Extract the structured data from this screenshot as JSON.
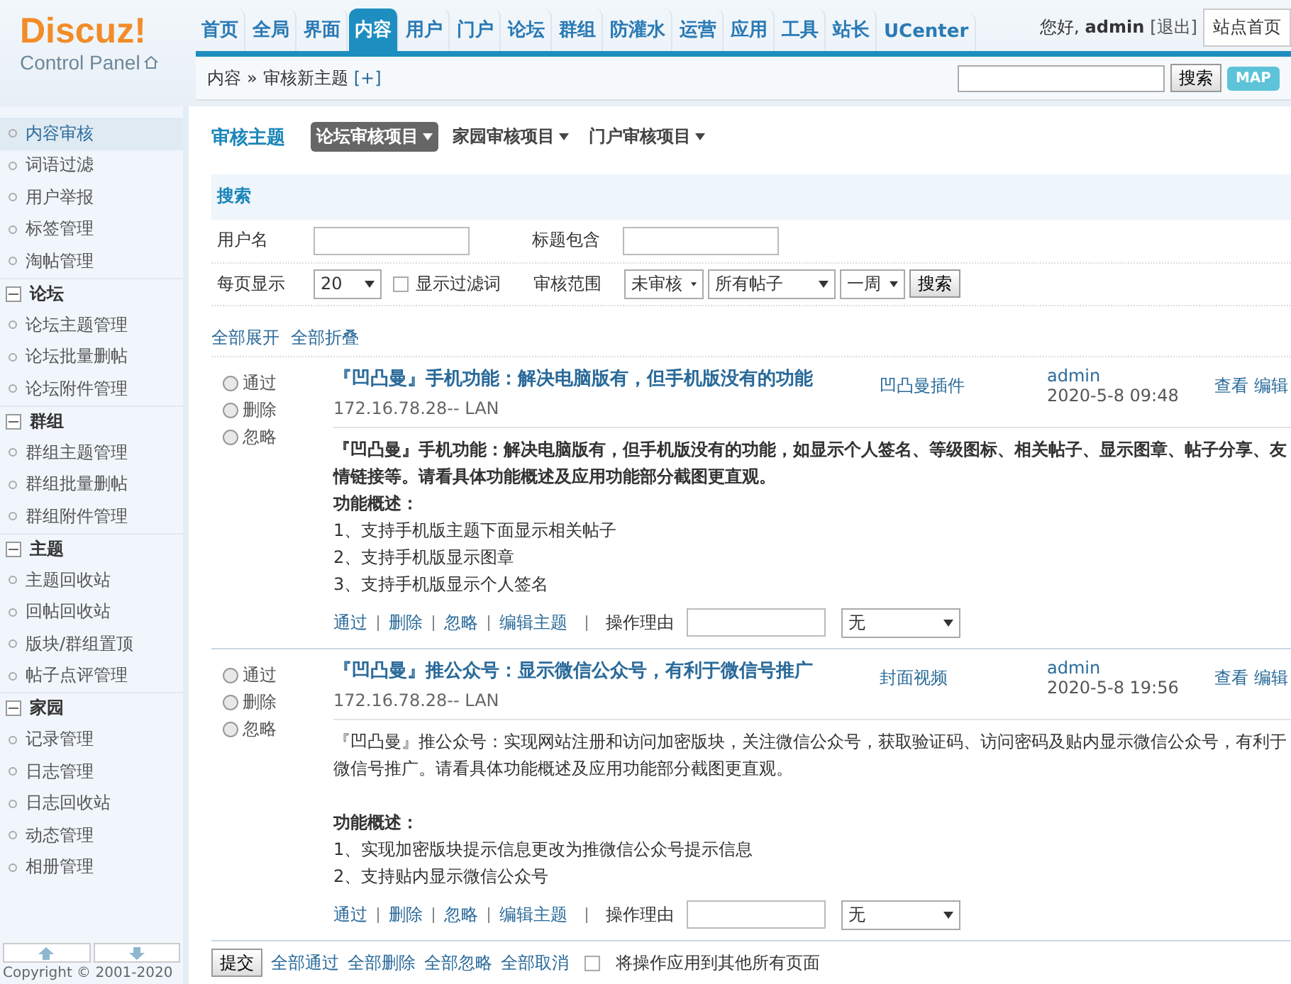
{
  "logo": {
    "title": "Discuz!",
    "subtitle": "Control Panel"
  },
  "nav": [
    {
      "label": "首页",
      "selected": false
    },
    {
      "label": "全局",
      "selected": false
    },
    {
      "label": "界面",
      "selected": false
    },
    {
      "label": "内容",
      "selected": true
    },
    {
      "label": "用户",
      "selected": false
    },
    {
      "label": "门户",
      "selected": false
    },
    {
      "label": "论坛",
      "selected": false
    },
    {
      "label": "群组",
      "selected": false
    },
    {
      "label": "防灌水",
      "selected": false
    },
    {
      "label": "运营",
      "selected": false
    },
    {
      "label": "应用",
      "selected": false
    },
    {
      "label": "工具",
      "selected": false
    },
    {
      "label": "站长",
      "selected": false
    },
    {
      "label": "UCenter",
      "selected": false
    }
  ],
  "user": {
    "greeting": "您好,",
    "name": "admin",
    "logout": "[退出]",
    "home": "站点首页"
  },
  "breadcrumb": {
    "section": "内容",
    "separator": "»",
    "page": "审核新主题",
    "add": "[+]"
  },
  "top_search": {
    "button": "搜索",
    "map": "MAP"
  },
  "sidebar": {
    "items": [
      {
        "label": "内容审核",
        "selected": true
      },
      {
        "label": "词语过滤",
        "selected": false
      },
      {
        "label": "用户举报",
        "selected": false
      },
      {
        "label": "标签管理",
        "selected": false
      },
      {
        "label": "淘帖管理",
        "selected": false
      }
    ],
    "groups": [
      {
        "title": "论坛",
        "expanded": true,
        "items": [
          {
            "label": "论坛主题管理",
            "selected": false
          },
          {
            "label": "论坛批量删帖",
            "selected": false
          },
          {
            "label": "论坛附件管理",
            "selected": false
          }
        ]
      },
      {
        "title": "群组",
        "expanded": true,
        "items": [
          {
            "label": "群组主题管理",
            "selected": false
          },
          {
            "label": "群组批量删帖",
            "selected": false
          },
          {
            "label": "群组附件管理",
            "selected": false
          }
        ]
      },
      {
        "title": "主题",
        "expanded": true,
        "items": [
          {
            "label": "主题回收站",
            "selected": false
          },
          {
            "label": "回帖回收站",
            "selected": false
          },
          {
            "label": "版块/群组置顶",
            "selected": false
          },
          {
            "label": "帖子点评管理",
            "selected": false
          }
        ]
      },
      {
        "title": "家园",
        "expanded": true,
        "items": [
          {
            "label": "记录管理",
            "selected": false
          },
          {
            "label": "日志管理",
            "selected": false
          },
          {
            "label": "日志回收站",
            "selected": false
          },
          {
            "label": "动态管理",
            "selected": false
          },
          {
            "label": "相册管理",
            "selected": false
          }
        ]
      }
    ],
    "copyright": "Copyright © 2001-2020"
  },
  "heading": "审核主题",
  "tabs": [
    {
      "label": "论坛审核项目",
      "selected": true
    },
    {
      "label": "家园审核项目",
      "selected": false
    },
    {
      "label": "门户审核项目",
      "selected": false
    }
  ],
  "search": {
    "title": "搜索",
    "username_label": "用户名",
    "title_label": "标题包含",
    "per_page_label": "每页显示",
    "per_page": "20",
    "show_filtered": {
      "label": "显示过滤词",
      "checked": false
    },
    "range_label": "审核范围",
    "status": "未审核",
    "scope": "所有帖子",
    "period": "一周",
    "button": "搜索"
  },
  "expand_all": "全部展开",
  "collapse_all": "全部折叠",
  "posts": [
    {
      "options": [
        {
          "label": "通过",
          "selected": false
        },
        {
          "label": "删除",
          "selected": false
        },
        {
          "label": "忽略",
          "selected": false
        }
      ],
      "title": "『凹凸曼』手机功能：解决电脑版有，但手机版没有的功能",
      "ip": "172.16.78.28-- LAN",
      "forum": "凹凸曼插件",
      "author": "admin",
      "date": "2020-5-8 09:48",
      "view": "查看",
      "edit": "编辑",
      "body": [
        {
          "text": "『凹凸曼』手机功能：解决电脑版有，但手机版没有的功能，如显示个人签名、等级图标、相关帖子、显示图章、帖子分享、友情链接等。请看具体功能概述及应用功能部分截图更直观。",
          "bold": true,
          "gap_before": false
        },
        {
          "text": "功能概述：",
          "bold": true,
          "gap_before": false
        },
        {
          "text": "1、支持手机版主题下面显示相关帖子",
          "bold": false,
          "gap_before": false
        },
        {
          "text": "2、支持手机版显示图章",
          "bold": false,
          "gap_before": false
        },
        {
          "text": "3、支持手机版显示个人签名",
          "bold": false,
          "gap_before": false
        }
      ],
      "actions": [
        "通过",
        "删除",
        "忽略",
        "编辑主题"
      ],
      "reason_label": "操作理由",
      "reason": "无"
    },
    {
      "options": [
        {
          "label": "通过",
          "selected": false
        },
        {
          "label": "删除",
          "selected": false
        },
        {
          "label": "忽略",
          "selected": false
        }
      ],
      "title": "『凹凸曼』推公众号：显示微信公众号，有利于微信号推广",
      "ip": "172.16.78.28-- LAN",
      "forum": "封面视频",
      "author": "admin",
      "date": "2020-5-8 19:56",
      "view": "查看",
      "edit": "编辑",
      "body": [
        {
          "text": "『凹凸曼』推公众号：实现网站注册和访问加密版块，关注微信公众号，获取验证码、访问密码及贴内显示微信公众号，有利于微信号推广。请看具体功能概述及应用功能部分截图更直观。",
          "bold": false,
          "gap_before": false
        },
        {
          "text": "功能概述：",
          "bold": true,
          "gap_before": true
        },
        {
          "text": "1、实现加密版块提示信息更改为推微信公众号提示信息",
          "bold": false,
          "gap_before": false
        },
        {
          "text": "2、支持贴内显示微信公众号",
          "bold": false,
          "gap_before": false
        }
      ],
      "actions": [
        "通过",
        "删除",
        "忽略",
        "编辑主题"
      ],
      "reason_label": "操作理由",
      "reason": "无"
    }
  ],
  "footer": {
    "submit": "提交",
    "links": [
      "全部通过",
      "全部删除",
      "全部忽略",
      "全部取消"
    ],
    "apply_all": {
      "label": "将操作应用到其他所有页面",
      "checked": false
    }
  }
}
